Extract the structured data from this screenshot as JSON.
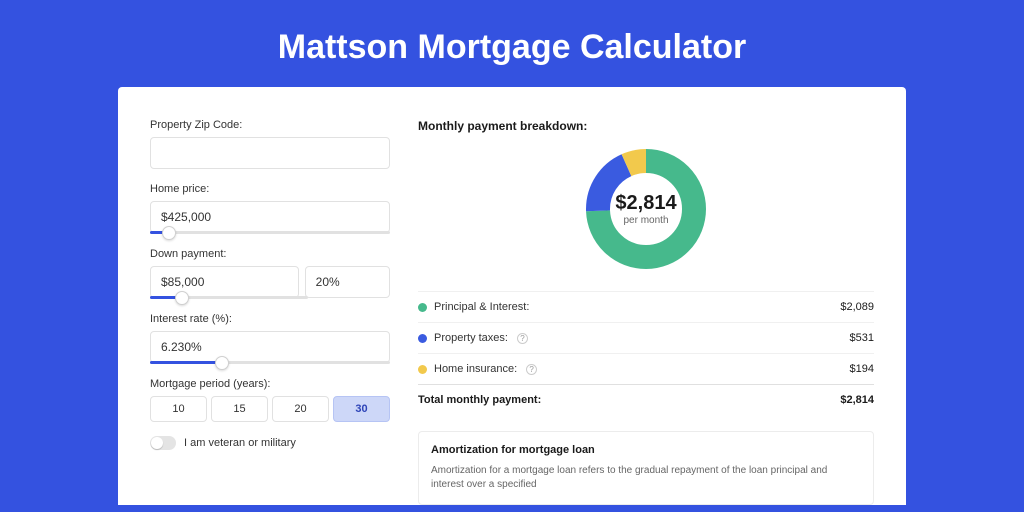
{
  "page": {
    "title": "Mattson Mortgage Calculator"
  },
  "form": {
    "zip": {
      "label": "Property Zip Code:",
      "value": ""
    },
    "home_price": {
      "label": "Home price:",
      "value": "$425,000",
      "slider_pct": 8
    },
    "down_payment": {
      "label": "Down payment:",
      "value": "$85,000",
      "pct": "20%",
      "slider_pct": 20
    },
    "interest": {
      "label": "Interest rate (%):",
      "value": "6.230%",
      "slider_pct": 30
    },
    "period": {
      "label": "Mortgage period (years):",
      "options": [
        "10",
        "15",
        "20",
        "30"
      ],
      "selected": "30"
    },
    "veteran": {
      "label": "I am veteran or military",
      "on": false
    }
  },
  "breakdown": {
    "title": "Monthly payment breakdown:",
    "total_value": "$2,814",
    "total_sub": "per month",
    "items": [
      {
        "label": "Principal & Interest:",
        "value": "$2,089",
        "color": "#46b98c",
        "help": false
      },
      {
        "label": "Property taxes:",
        "value": "$531",
        "color": "#3a5be0",
        "help": true
      },
      {
        "label": "Home insurance:",
        "value": "$194",
        "color": "#f2c94c",
        "help": true
      }
    ],
    "total_row": {
      "label": "Total monthly payment:",
      "value": "$2,814"
    }
  },
  "amortization": {
    "title": "Amortization for mortgage loan",
    "text": "Amortization for a mortgage loan refers to the gradual repayment of the loan principal and interest over a specified"
  },
  "chart_data": {
    "type": "pie",
    "title": "Monthly payment breakdown",
    "center_label": "$2,814 per month",
    "series": [
      {
        "name": "Principal & Interest",
        "value": 2089,
        "color": "#46b98c"
      },
      {
        "name": "Property taxes",
        "value": 531,
        "color": "#3a5be0"
      },
      {
        "name": "Home insurance",
        "value": 194,
        "color": "#f2c94c"
      }
    ],
    "total": 2814
  }
}
